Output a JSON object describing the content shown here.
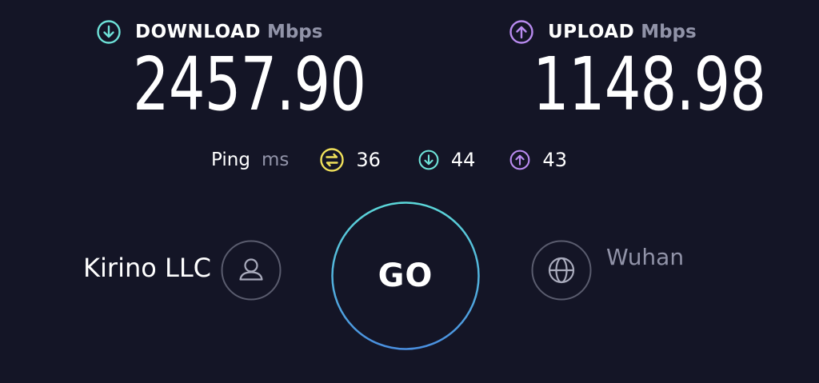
{
  "download": {
    "label": "DOWNLOAD",
    "unit": "Mbps",
    "value": "2457.90",
    "icon": "download-arrow-icon",
    "color": "#6ee2d8"
  },
  "upload": {
    "label": "UPLOAD",
    "unit": "Mbps",
    "value": "1148.98",
    "icon": "upload-arrow-icon",
    "color": "#b98bf0"
  },
  "ping": {
    "label": "Ping",
    "unit": "ms",
    "idle": {
      "value": "36",
      "icon": "idle-ping-icon",
      "color": "#f0e05a"
    },
    "download": {
      "value": "44",
      "icon": "download-ping-icon",
      "color": "#6ee2d8"
    },
    "upload": {
      "value": "43",
      "icon": "upload-ping-icon",
      "color": "#b98bf0"
    }
  },
  "go_button": {
    "label": "GO",
    "ring_color_start": "#5bd6d8",
    "ring_color_end": "#4a8fe0"
  },
  "provider": {
    "name": "Kirino LLC",
    "icon": "user-icon"
  },
  "server": {
    "name": "Wuhan",
    "icon": "globe-icon"
  },
  "colors": {
    "background": "#141526",
    "muted_text": "#9193a8",
    "circle_stroke": "#5a5c6e"
  }
}
